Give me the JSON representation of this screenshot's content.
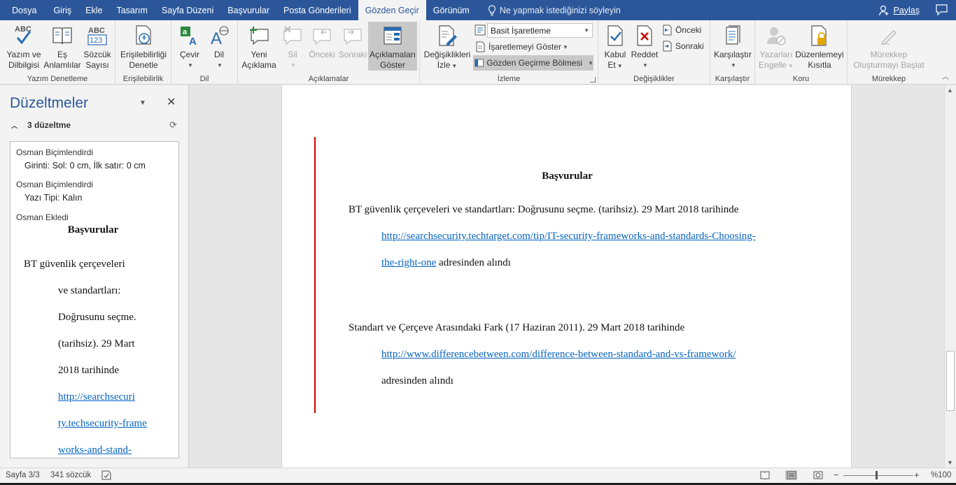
{
  "tabs": [
    {
      "label": "Dosya"
    },
    {
      "label": "Giriş"
    },
    {
      "label": "Ekle"
    },
    {
      "label": "Tasarım"
    },
    {
      "label": "Sayfa Düzeni"
    },
    {
      "label": "Başvurular"
    },
    {
      "label": "Posta Gönderileri"
    },
    {
      "label": "Gözden Geçir",
      "active": true
    },
    {
      "label": "Görünüm"
    }
  ],
  "tell_me": "Ne yapmak istediğinizi söyleyin",
  "share": "Paylaş",
  "ribbon": {
    "groups": {
      "proofing": "Yazım Denetleme",
      "accessibility": "Erişilebilirlik",
      "language": "Dil",
      "comments": "Açıklamalar",
      "tracking": "İzleme",
      "changes": "Değişiklikler",
      "compare": "Karşılaştır",
      "protect": "Koru",
      "ink": "Mürekkep"
    },
    "buttons": {
      "spelling_1": "Yazım ve",
      "spelling_2": "Dilbilgisi",
      "thesaurus_1": "Eş",
      "thesaurus_2": "Anlamlılar",
      "wordcount_1": "Sözcük",
      "wordcount_2": "Sayısı",
      "accessibility_1": "Erişilebilirliği",
      "accessibility_2": "Denetle",
      "translate": "Çevir",
      "language": "Dil",
      "new_comment_1": "Yeni",
      "new_comment_2": "Açıklama",
      "delete": "Sil",
      "previous_comment": "Önceki",
      "next_comment": "Sonraki",
      "show_comments_1": "Açıklamaları",
      "show_comments_2": "Göster",
      "track_changes_1": "Değişiklikleri",
      "track_changes_2": "İzle",
      "markup_dropdown": "Basit İşaretleme",
      "show_markup": "İşaretlemeyi Göster",
      "reviewing_pane": "Gözden Geçirme Bölmesi",
      "accept_1": "Kabul",
      "accept_2": "Et",
      "reject": "Reddet",
      "previous_change": "Önceki",
      "next_change": "Sonraki",
      "compare": "Karşılaştır",
      "block_authors_1": "Yazarları",
      "block_authors_2": "Engelle",
      "restrict_editing_1": "Düzenlemeyi",
      "restrict_editing_2": "Kısıtla",
      "start_inking_1": "Mürekkep",
      "start_inking_2": "Oluşturmayı Başlat",
      "abc": "ABC",
      "abc123_top": "ABC",
      "abc123_bottom": "123"
    }
  },
  "revisions_pane": {
    "title": "Düzeltmeler",
    "count": "3 düzeltme",
    "items": [
      {
        "author": "Osman Biçimlendirdi",
        "detail": "Girinti: Sol: 0 cm, İlk satır: 0 cm"
      },
      {
        "author": "Osman Biçimlendirdi",
        "detail": "Yazı Tipi: Kalın"
      },
      {
        "author": "Osman Ekledi"
      }
    ],
    "inserted_title": "Başvurular",
    "inserted_lines": [
      "BT güvenlik çerçeveleri",
      "ve standartları:",
      "Doğrusunu seçme.",
      "(tarihsiz). 29 Mart",
      "2018 tarihinde"
    ],
    "inserted_links": [
      "http://searchsecuri",
      "ty.techsecurity-frame",
      "works-and-stand-"
    ]
  },
  "document": {
    "heading": "Başvurular",
    "ref1": {
      "text": "BT güvenlik çerçeveleri ve standartları: Doğrusunu seçme. (tarihsiz). 29 Mart 2018 tarihinde",
      "link_part1": "http://searchsecurity.techtarget.com/tip/IT-security-frameworks-and-standards-Choosing-",
      "link_part2": "the-right-one",
      "suffix": " adresinden alındı"
    },
    "ref2": {
      "text": "Standart ve Çerçeve Arasındaki Fark (17 Haziran 2011). 29 Mart 2018 tarihinde",
      "link": "http://www.differencebetween.com/difference-between-standard-and-vs-framework/",
      "suffix": "adresinden alındı"
    }
  },
  "status": {
    "page": "Sayfa 3/3",
    "words": "341 sözcük",
    "zoom": "%100"
  },
  "colors": {
    "accent": "#2b579a",
    "link": "#0563c1",
    "change_bar": "#d00000"
  }
}
